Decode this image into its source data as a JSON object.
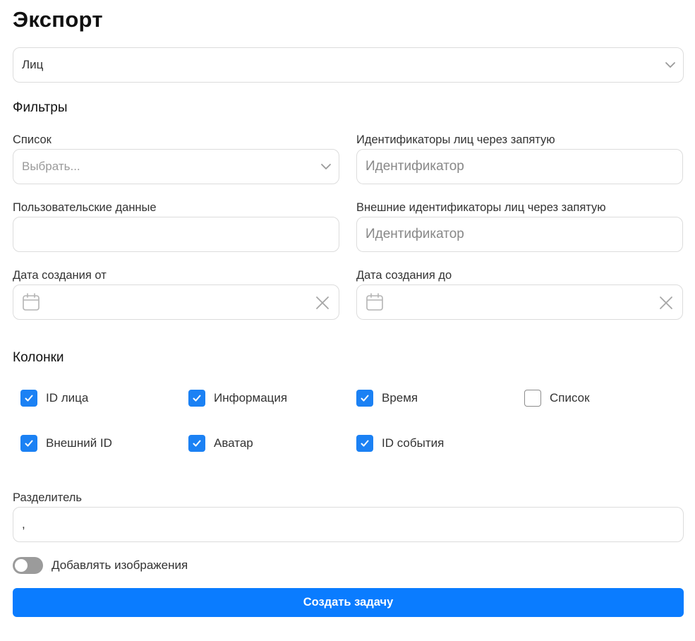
{
  "page": {
    "title": "Экспорт"
  },
  "export_type": {
    "value": "Лиц"
  },
  "filters": {
    "heading": "Фильтры",
    "list": {
      "label": "Список",
      "placeholder": "Выбрать..."
    },
    "face_ids": {
      "label": "Идентификаторы лиц через запятую",
      "placeholder": "Идентификатор"
    },
    "user_data": {
      "label": "Пользовательские данные",
      "value": ""
    },
    "external_ids": {
      "label": "Внешние идентификаторы лиц через запятую",
      "placeholder": "Идентификатор"
    },
    "created_from": {
      "label": "Дата создания от"
    },
    "created_to": {
      "label": "Дата создания до"
    }
  },
  "columns": {
    "heading": "Колонки",
    "items": [
      {
        "label": "ID лица",
        "checked": true
      },
      {
        "label": "Информация",
        "checked": true
      },
      {
        "label": "Время",
        "checked": true
      },
      {
        "label": "Список",
        "checked": false
      },
      {
        "label": "Внешний ID",
        "checked": true
      },
      {
        "label": "Аватар",
        "checked": true
      },
      {
        "label": "ID события",
        "checked": true
      }
    ]
  },
  "separator": {
    "label": "Разделитель",
    "value": ","
  },
  "add_images": {
    "label": "Добавлять изображения",
    "enabled": false
  },
  "submit": {
    "label": "Создать задачу"
  },
  "colors": {
    "accent": "#0a7cff",
    "checkbox": "#1b81f4",
    "border": "#dcdcdc"
  },
  "icons": {
    "dropdown": "chevron-down-icon",
    "date": "calendar-icon",
    "clear": "close-icon",
    "check": "checkmark-icon"
  }
}
